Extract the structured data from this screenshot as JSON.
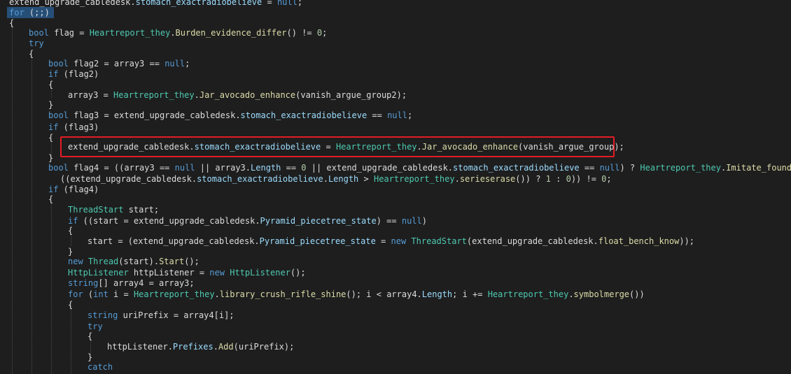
{
  "editor": {
    "lines": [
      [
        [
          "pl",
          "extend_upgrade_cabledesk."
        ],
        [
          "id",
          "stomach_exactradiobelieve"
        ],
        [
          "pl",
          " = "
        ],
        [
          "kw",
          "null"
        ],
        [
          "pl",
          ";"
        ]
      ],
      [
        [
          "kw",
          "for"
        ],
        [
          "pl",
          " (;;)"
        ]
      ],
      [
        [
          "pl",
          "{"
        ]
      ],
      [
        [
          "kw",
          "bool"
        ],
        [
          "pl",
          " flag = "
        ],
        [
          "ty",
          "Heartreport_they"
        ],
        [
          "pl",
          "."
        ],
        [
          "mb",
          "Burden_evidence_differ"
        ],
        [
          "pl",
          "() != "
        ],
        [
          "lit",
          "0"
        ],
        [
          "pl",
          ";"
        ]
      ],
      [
        [
          "kw",
          "try"
        ]
      ],
      [
        [
          "pl",
          "{"
        ]
      ],
      [
        [
          "kw",
          "bool"
        ],
        [
          "pl",
          " flag2 = array3 == "
        ],
        [
          "kw",
          "null"
        ],
        [
          "pl",
          ";"
        ]
      ],
      [
        [
          "kw",
          "if"
        ],
        [
          "pl",
          " (flag2)"
        ]
      ],
      [
        [
          "pl",
          "{"
        ]
      ],
      [
        [
          "pl",
          "array3 = "
        ],
        [
          "ty",
          "Heartreport_they"
        ],
        [
          "pl",
          "."
        ],
        [
          "mb",
          "Jar_avocado_enhance"
        ],
        [
          "pl",
          "(vanish_argue_group2);"
        ]
      ],
      [
        [
          "pl",
          "}"
        ]
      ],
      [
        [
          "kw",
          "bool"
        ],
        [
          "pl",
          " flag3 = extend_upgrade_cabledesk."
        ],
        [
          "id",
          "stomach_exactradiobelieve"
        ],
        [
          "pl",
          " == "
        ],
        [
          "kw",
          "null"
        ],
        [
          "pl",
          ";"
        ]
      ],
      [
        [
          "kw",
          "if"
        ],
        [
          "pl",
          " (flag3)"
        ]
      ],
      [
        [
          "pl",
          "{"
        ]
      ],
      [
        [
          "pl",
          "extend_upgrade_cabledesk."
        ],
        [
          "id",
          "stomach_exactradiobelieve"
        ],
        [
          "pl",
          " = "
        ],
        [
          "ty",
          "Heartreport_they"
        ],
        [
          "pl",
          "."
        ],
        [
          "mb",
          "Jar_avocado_enhance"
        ],
        [
          "pl",
          "(vanish_argue_group);"
        ]
      ],
      [
        [
          "pl",
          "}"
        ]
      ],
      [
        [
          "kw",
          "bool"
        ],
        [
          "pl",
          " flag4 = ((array3 == "
        ],
        [
          "kw",
          "null"
        ],
        [
          "pl",
          " || array3."
        ],
        [
          "id",
          "Length"
        ],
        [
          "pl",
          " == "
        ],
        [
          "lit",
          "0"
        ],
        [
          "pl",
          " || extend_upgrade_cabledesk."
        ],
        [
          "id",
          "stomach_exactradiobelieve"
        ],
        [
          "pl",
          " == "
        ],
        [
          "kw",
          "null"
        ],
        [
          "pl",
          ") ? "
        ],
        [
          "ty",
          "Heartreport_they"
        ],
        [
          "pl",
          "."
        ],
        [
          "mb",
          "Imitate_found"
        ],
        [
          "pl",
          "() :"
        ]
      ],
      [
        [
          "pl",
          "((extend_upgrade_cabledesk."
        ],
        [
          "id",
          "stomach_exactradiobelieve"
        ],
        [
          "pl",
          "."
        ],
        [
          "id",
          "Length"
        ],
        [
          "pl",
          " > "
        ],
        [
          "ty",
          "Heartreport_they"
        ],
        [
          "pl",
          "."
        ],
        [
          "mb",
          "serieserase"
        ],
        [
          "pl",
          "()) ? "
        ],
        [
          "lit",
          "1"
        ],
        [
          "pl",
          " : "
        ],
        [
          "lit",
          "0"
        ],
        [
          "pl",
          ")) != "
        ],
        [
          "lit",
          "0"
        ],
        [
          "pl",
          ";"
        ]
      ],
      [
        [
          "kw",
          "if"
        ],
        [
          "pl",
          " (flag4)"
        ]
      ],
      [
        [
          "pl",
          "{"
        ]
      ],
      [
        [
          "ty",
          "ThreadStart"
        ],
        [
          "pl",
          " start;"
        ]
      ],
      [
        [
          "kw",
          "if"
        ],
        [
          "pl",
          " ((start = extend_upgrade_cabledesk."
        ],
        [
          "id",
          "Pyramid_piecetree_state"
        ],
        [
          "pl",
          ") == "
        ],
        [
          "kw",
          "null"
        ],
        [
          "pl",
          ")"
        ]
      ],
      [
        [
          "pl",
          "{"
        ]
      ],
      [
        [
          "pl",
          "start = (extend_upgrade_cabledesk."
        ],
        [
          "id",
          "Pyramid_piecetree_state"
        ],
        [
          "pl",
          " = "
        ],
        [
          "kw",
          "new"
        ],
        [
          "pl",
          " "
        ],
        [
          "ty",
          "ThreadStart"
        ],
        [
          "pl",
          "(extend_upgrade_cabledesk."
        ],
        [
          "mb",
          "float_bench_know"
        ],
        [
          "pl",
          "));"
        ]
      ],
      [
        [
          "pl",
          "}"
        ]
      ],
      [
        [
          "kw",
          "new"
        ],
        [
          "pl",
          " "
        ],
        [
          "ty",
          "Thread"
        ],
        [
          "pl",
          "(start)."
        ],
        [
          "mb",
          "Start"
        ],
        [
          "pl",
          "();"
        ]
      ],
      [
        [
          "ty",
          "HttpListener"
        ],
        [
          "pl",
          " httpListener = "
        ],
        [
          "kw",
          "new"
        ],
        [
          "pl",
          " "
        ],
        [
          "ty",
          "HttpListener"
        ],
        [
          "pl",
          "();"
        ]
      ],
      [
        [
          "kw",
          "string"
        ],
        [
          "pl",
          "[] array4 = array3;"
        ]
      ],
      [
        [
          "kw",
          "for"
        ],
        [
          "pl",
          " ("
        ],
        [
          "kw",
          "int"
        ],
        [
          "pl",
          " i = "
        ],
        [
          "ty",
          "Heartreport_they"
        ],
        [
          "pl",
          "."
        ],
        [
          "mb",
          "library_crush_rifle_shine"
        ],
        [
          "pl",
          "(); i < array4."
        ],
        [
          "id",
          "Length"
        ],
        [
          "pl",
          "; i += "
        ],
        [
          "ty",
          "Heartreport_they"
        ],
        [
          "pl",
          "."
        ],
        [
          "mb",
          "symbolmerge"
        ],
        [
          "pl",
          "())"
        ]
      ],
      [
        [
          "pl",
          "{"
        ]
      ],
      [
        [
          "kw",
          "string"
        ],
        [
          "pl",
          " uriPrefix = array4[i];"
        ]
      ],
      [
        [
          "kw",
          "try"
        ]
      ],
      [
        [
          "pl",
          "{"
        ]
      ],
      [
        [
          "pl",
          "httpListener."
        ],
        [
          "id",
          "Prefixes"
        ],
        [
          "pl",
          "."
        ],
        [
          "mb",
          "Add"
        ],
        [
          "pl",
          "(uriPrefix);"
        ]
      ],
      [
        [
          "pl",
          "}"
        ]
      ],
      [
        [
          "kw",
          "catch"
        ]
      ]
    ]
  }
}
